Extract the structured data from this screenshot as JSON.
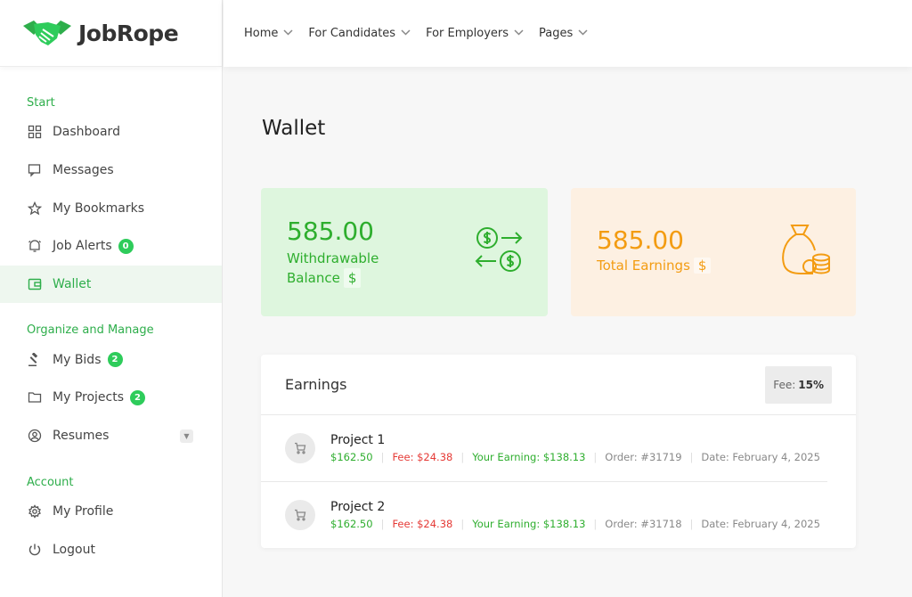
{
  "brand": {
    "name": "JobRope",
    "color": "#2eae4b"
  },
  "topnav": [
    {
      "label": "Home"
    },
    {
      "label": "For Candidates"
    },
    {
      "label": "For Employers"
    },
    {
      "label": "Pages"
    }
  ],
  "sidebar": {
    "sections": [
      {
        "title": "Start",
        "items": [
          {
            "label": "Dashboard",
            "icon": "dashboard-icon"
          },
          {
            "label": "Messages",
            "icon": "messages-icon"
          },
          {
            "label": "My Bookmarks",
            "icon": "star-icon"
          },
          {
            "label": "Job Alerts",
            "icon": "bell-icon",
            "badge": "0"
          },
          {
            "label": "Wallet",
            "icon": "wallet-icon",
            "active": true
          }
        ]
      },
      {
        "title": "Organize and Manage",
        "items": [
          {
            "label": "My Bids",
            "icon": "gavel-icon",
            "badge": "2"
          },
          {
            "label": "My Projects",
            "icon": "folder-icon",
            "badge": "2"
          },
          {
            "label": "Resumes",
            "icon": "user-circle-icon",
            "dropdown": true
          }
        ]
      },
      {
        "title": "Account",
        "items": [
          {
            "label": "My Profile",
            "icon": "gear-icon"
          },
          {
            "label": "Logout",
            "icon": "power-icon"
          }
        ]
      }
    ]
  },
  "page": {
    "title": "Wallet"
  },
  "cards": {
    "withdrawable": {
      "value": "585.00",
      "label_line1": "Withdrawable",
      "label_line2": "Balance",
      "unit": "$",
      "color": "#2eae2e"
    },
    "total": {
      "value": "585.00",
      "label": "Total Earnings",
      "unit": "$",
      "color": "#f39c12"
    }
  },
  "earnings": {
    "title": "Earnings",
    "fee_label": "Fee:",
    "fee_value": "15%",
    "rows": [
      {
        "name": "Project 1",
        "amount": "$162.50",
        "fee": "Fee: $24.38",
        "earning": "Your Earning: $138.13",
        "order": "Order: #31719",
        "date": "Date: February 4, 2025"
      },
      {
        "name": "Project 2",
        "amount": "$162.50",
        "fee": "Fee: $24.38",
        "earning": "Your Earning: $138.13",
        "order": "Order: #31718",
        "date": "Date: February 4, 2025"
      }
    ]
  }
}
